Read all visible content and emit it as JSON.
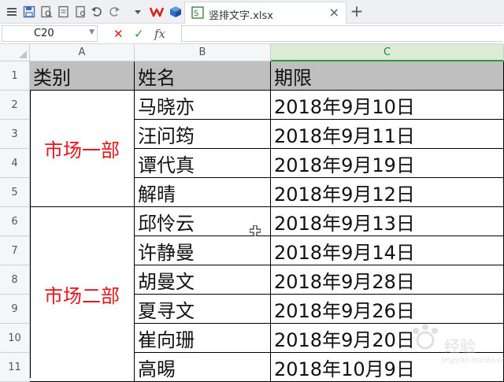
{
  "toolbar": {
    "icons": [
      "app-menu-icon",
      "save-icon",
      "print-preview-icon",
      "export-icon",
      "print-icon",
      "undo-icon",
      "redo-icon",
      "dropdown-icon",
      "wps-logo-icon",
      "cube-icon"
    ]
  },
  "tab": {
    "filename": "竖排文字.xlsx",
    "close_glyph": "×",
    "add_glyph": "+"
  },
  "formula_bar": {
    "name_box": "C20",
    "cancel_glyph": "✕",
    "confirm_glyph": "✓",
    "fx_label": "fx",
    "content": ""
  },
  "colors": {
    "category_text": "#e8141b",
    "header_fill": "#bfbfbf",
    "active_column": "#dcebd6"
  },
  "sheet": {
    "columns": [
      "A",
      "B",
      "C"
    ],
    "active_column": "C",
    "rows": [
      "1",
      "2",
      "3",
      "4",
      "5",
      "6",
      "7",
      "8",
      "9",
      "10",
      "11"
    ],
    "header": {
      "a": "类别",
      "b": "姓名",
      "c": "期限"
    },
    "groups": [
      {
        "category": "市场一部",
        "rows": [
          {
            "name": "马晓亦",
            "date": "2018年9月10日"
          },
          {
            "name": "汪问筠",
            "date": "2018年9月11日"
          },
          {
            "name": "谭代真",
            "date": "2018年9月19日"
          },
          {
            "name": "解晴",
            "date": "2018年9月12日"
          }
        ]
      },
      {
        "category": "市场二部",
        "rows": [
          {
            "name": "邱怜云",
            "date": "2018年9月13日"
          },
          {
            "name": "许静曼",
            "date": "2018年9月14日"
          },
          {
            "name": "胡曼文",
            "date": "2018年9月28日"
          },
          {
            "name": "夏寻文",
            "date": "2018年9月26日"
          },
          {
            "name": "崔向珊",
            "date": "2018年9月20日"
          },
          {
            "name": "高晹",
            "date": "2018年10月9日"
          }
        ]
      }
    ]
  },
  "watermark": {
    "text": "经验",
    "sub": "jingyan.baidu.com"
  }
}
